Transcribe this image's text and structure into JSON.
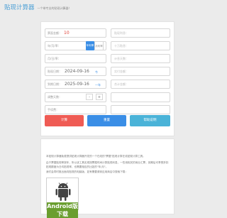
{
  "header": {
    "title": "贴现计算器",
    "subtitle": "一个带专业的贴现计算器！"
  },
  "form": {
    "amount": {
      "label": "票面金额：",
      "value": "10",
      "suffix": "万"
    },
    "rate": {
      "label": "年/月/率：",
      "unit_year": "年利率",
      "unit_month": "月利率"
    },
    "fee": {
      "label": "月/日/率："
    },
    "discount_date": {
      "label": "贴现日期：",
      "value": "2024-09-16",
      "chip": "今"
    },
    "due_date": {
      "label": "到期日期：",
      "value": "2025-09-16",
      "chip": "一年"
    },
    "adj_days": {
      "label": "调整天数：",
      "minus": "-",
      "plus": "+"
    },
    "remark": {
      "label": "手续费："
    },
    "result": {
      "interest": "贴现利息：",
      "per_100k": "十万贴息：",
      "days": "计息天数：",
      "actual": "实付金额：",
      "total": "合计金额："
    }
  },
  "buttons": {
    "calc": "计算",
    "reset": "重置",
    "help": "帮助说明"
  },
  "colors": {
    "calc": "#ef5b54",
    "reset": "#3a8ee6",
    "help": "#4ab3d8"
  },
  "info": {
    "p1": "本贴现计算器免费提供贴现计算器开发的一个在线的\"票据\"贴现计算在线贴现计算工具。",
    "p2": "由于票据贴现率按年，所以该工具实现按票据时间计算贴现利息，一些用相关的商业汇票，到期后可享受折扣贴现额度为日均贴现率，也需要相应的比如的\"年/月\"。",
    "p3": "我们会同时推出面向贴现的电脑版，如有需要请到应用商店中搜索下载：",
    "download_label": "Android版下载"
  }
}
